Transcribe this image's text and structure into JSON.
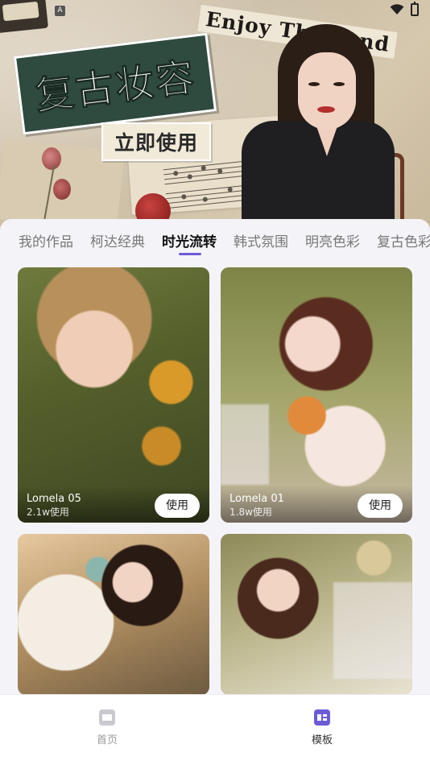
{
  "status_bar": {
    "indicator": "A",
    "icons": [
      "wifi-icon",
      "battery-icon"
    ]
  },
  "banner": {
    "title": "复古妆容",
    "cta_label": "立即使用",
    "slogan": "Enjoy Th     ekend"
  },
  "tabs": [
    {
      "label": "我的作品",
      "active": false
    },
    {
      "label": "柯达经典",
      "active": false
    },
    {
      "label": "时光流转",
      "active": true
    },
    {
      "label": "韩式氛围",
      "active": false
    },
    {
      "label": "明亮色彩",
      "active": false
    },
    {
      "label": "复古色彩",
      "active": false
    }
  ],
  "templates": [
    {
      "name": "Lomela 05",
      "usage": "2.1w使用",
      "button": "使用"
    },
    {
      "name": "Lomela 01",
      "usage": "1.8w使用",
      "button": "使用"
    },
    {
      "name": "",
      "usage": "",
      "button": ""
    },
    {
      "name": "",
      "usage": "",
      "button": ""
    }
  ],
  "bottom_nav": {
    "items": [
      {
        "label": "首页",
        "icon": "home-icon",
        "active": false
      },
      {
        "label": "模板",
        "icon": "template-icon",
        "active": true
      }
    ]
  },
  "colors": {
    "accent": "#6b5cd6",
    "banner_title_bg": "#2f4a3e",
    "page_bg": "#f4f3f8"
  }
}
